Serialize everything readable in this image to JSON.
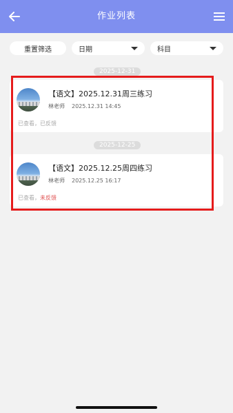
{
  "header": {
    "title": "作业列表",
    "back_icon": "arrow-left-icon",
    "menu_icon": "hamburger-menu-icon",
    "color": "#7f8fef"
  },
  "filters": {
    "reset_label": "重置筛选",
    "date_label": "日期",
    "subject_label": "科目"
  },
  "groups": [
    {
      "date": "2025-12-31",
      "card": {
        "title": "【语文】2025.12.31周三练习",
        "teacher": "林老师",
        "time": "2025.12.31 14:45",
        "status_viewed": "已查看，",
        "status_feedback": "已反馈"
      }
    },
    {
      "date": "2025-12-25",
      "card": {
        "title": "【语文】2025.12.25周四练习",
        "teacher": "林老师",
        "time": "2025.12.25 16:17",
        "status_viewed": "已查看，",
        "status_feedback": "未反馈"
      }
    }
  ],
  "colors": {
    "feedback_pending": "#e05454",
    "highlight_border": "#e51b1b"
  }
}
